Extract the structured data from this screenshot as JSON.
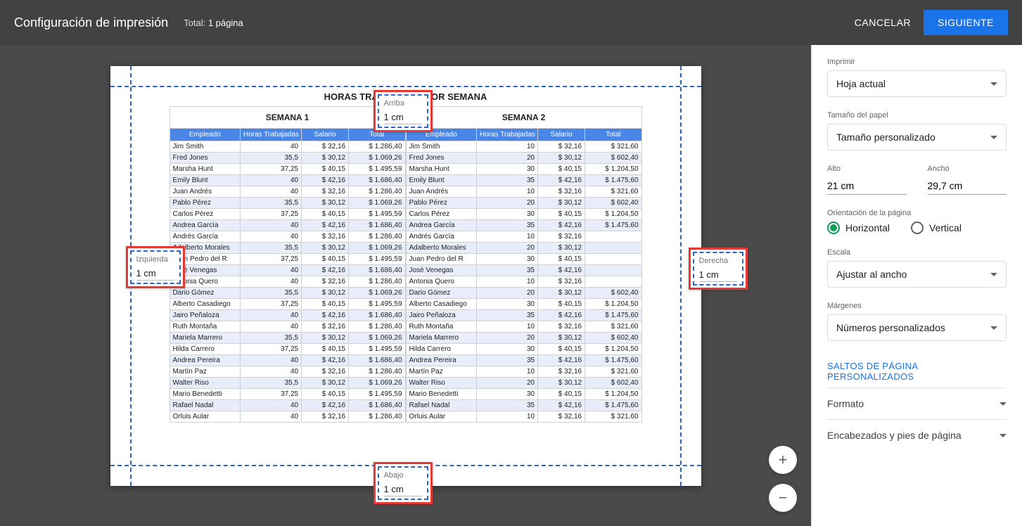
{
  "header": {
    "title": "Configuración de impresión",
    "total_label": "Total:",
    "total_value": "1 página",
    "cancel": "Cancelar",
    "next": "Siguiente"
  },
  "sidebar": {
    "print_label": "Imprimir",
    "print_value": "Hoja actual",
    "paper_label": "Tamaño del papel",
    "paper_value": "Tamaño personalizado",
    "height_label": "Alto",
    "height_value": "21 cm",
    "width_label": "Ancho",
    "width_value": "29,7 cm",
    "orient_label": "Orientación de la página",
    "orient_h": "Horizontal",
    "orient_v": "Vertical",
    "scale_label": "Escala",
    "scale_value": "Ajustar al ancho",
    "margins_label": "Márgenes",
    "margins_value": "Números personalizados",
    "page_breaks": "Saltos de página personalizados",
    "format": "Formato",
    "headers_footers": "Encabezados y pies de página"
  },
  "preview": {
    "doc_title": "HORAS TRABAJADAS POR SEMANA",
    "week1_title": "SEMANA 1",
    "week2_title": "SEMANA 2",
    "columns": {
      "emp": "Empleado",
      "hours": "Horas Trabajadas",
      "salary": "Salario",
      "total": "Total"
    },
    "margins": {
      "top_label": "Arriba",
      "top_value": "1 cm",
      "bottom_label": "Abajo",
      "bottom_value": "1 cm",
      "left_label": "Izquierda",
      "left_value": "1 cm",
      "right_label": "Derecha",
      "right_value": "1 cm"
    }
  },
  "chart_data": {
    "type": "table",
    "week1": [
      {
        "emp": "Jim Smith",
        "hours": "40",
        "salary": "$ 32,16",
        "total": "$ 1.286,40"
      },
      {
        "emp": "Fred Jones",
        "hours": "35,5",
        "salary": "$ 30,12",
        "total": "$ 1.069,26"
      },
      {
        "emp": "Marsha Hunt",
        "hours": "37,25",
        "salary": "$ 40,15",
        "total": "$ 1.495,59"
      },
      {
        "emp": "Emily Blunt",
        "hours": "40",
        "salary": "$ 42,16",
        "total": "$ 1.686,40"
      },
      {
        "emp": "Juan Andrés",
        "hours": "40",
        "salary": "$ 32,16",
        "total": "$ 1.286,40"
      },
      {
        "emp": "Pablo Pérez",
        "hours": "35,5",
        "salary": "$ 30,12",
        "total": "$ 1.069,26"
      },
      {
        "emp": "Carlos Pérez",
        "hours": "37,25",
        "salary": "$ 40,15",
        "total": "$ 1.495,59"
      },
      {
        "emp": "Andrea García",
        "hours": "40",
        "salary": "$ 42,16",
        "total": "$ 1.686,40"
      },
      {
        "emp": "Andrés García",
        "hours": "40",
        "salary": "$ 32,16",
        "total": "$ 1.286,40"
      },
      {
        "emp": "Adalberto Morales",
        "hours": "35,5",
        "salary": "$ 30,12",
        "total": "$ 1.069,26"
      },
      {
        "emp": "Juan Pedro del R",
        "hours": "37,25",
        "salary": "$ 40,15",
        "total": "$ 1.495,59"
      },
      {
        "emp": "José Venegas",
        "hours": "40",
        "salary": "$ 42,16",
        "total": "$ 1.686,40"
      },
      {
        "emp": "Antonia Quero",
        "hours": "40",
        "salary": "$ 32,16",
        "total": "$ 1.286,40"
      },
      {
        "emp": "Dario Gómez",
        "hours": "35,5",
        "salary": "$ 30,12",
        "total": "$ 1.069,26"
      },
      {
        "emp": "Alberto Casadiego",
        "hours": "37,25",
        "salary": "$ 40,15",
        "total": "$ 1.495,59"
      },
      {
        "emp": "Jairo Peñaloza",
        "hours": "40",
        "salary": "$ 42,16",
        "total": "$ 1.686,40"
      },
      {
        "emp": "Ruth Montaña",
        "hours": "40",
        "salary": "$ 32,16",
        "total": "$ 1.286,40"
      },
      {
        "emp": "Mariela Marrero",
        "hours": "35,5",
        "salary": "$ 30,12",
        "total": "$ 1.069,26"
      },
      {
        "emp": "Hilda Carrero",
        "hours": "37,25",
        "salary": "$ 40,15",
        "total": "$ 1.495,59"
      },
      {
        "emp": "Andrea Pereira",
        "hours": "40",
        "salary": "$ 42,16",
        "total": "$ 1.686,40"
      },
      {
        "emp": "Martín Paz",
        "hours": "40",
        "salary": "$ 32,16",
        "total": "$ 1.286,40"
      },
      {
        "emp": "Walter Riso",
        "hours": "35,5",
        "salary": "$ 30,12",
        "total": "$ 1.069,26"
      },
      {
        "emp": "Mario Benedetti",
        "hours": "37,25",
        "salary": "$ 40,15",
        "total": "$ 1.495,59"
      },
      {
        "emp": "Rafael Nadal",
        "hours": "40",
        "salary": "$ 42,16",
        "total": "$ 1.686,40"
      },
      {
        "emp": "Orluis Aular",
        "hours": "40",
        "salary": "$ 32,16",
        "total": "$ 1.286,40"
      }
    ],
    "week2": [
      {
        "emp": "Jim Smith",
        "hours": "10",
        "salary": "$ 32,16",
        "total": "$ 321,60"
      },
      {
        "emp": "Fred Jones",
        "hours": "20",
        "salary": "$ 30,12",
        "total": "$ 602,40"
      },
      {
        "emp": "Marsha Hunt",
        "hours": "30",
        "salary": "$ 40,15",
        "total": "$ 1.204,50"
      },
      {
        "emp": "Emily Blunt",
        "hours": "35",
        "salary": "$ 42,16",
        "total": "$ 1.475,60"
      },
      {
        "emp": "Juan Andrés",
        "hours": "10",
        "salary": "$ 32,16",
        "total": "$ 321,60"
      },
      {
        "emp": "Pablo Pérez",
        "hours": "20",
        "salary": "$ 30,12",
        "total": "$ 602,40"
      },
      {
        "emp": "Carlos Pérez",
        "hours": "30",
        "salary": "$ 40,15",
        "total": "$ 1.204,50"
      },
      {
        "emp": "Andrea García",
        "hours": "35",
        "salary": "$ 42,16",
        "total": "$ 1.475,60"
      },
      {
        "emp": "Andrés García",
        "hours": "10",
        "salary": "$ 32,16",
        "total": ""
      },
      {
        "emp": "Adalberto Morales",
        "hours": "20",
        "salary": "$ 30,12",
        "total": ""
      },
      {
        "emp": "Juan Pedro del R",
        "hours": "30",
        "salary": "$ 40,15",
        "total": ""
      },
      {
        "emp": "José Venegas",
        "hours": "35",
        "salary": "$ 42,16",
        "total": ""
      },
      {
        "emp": "Antonia Quero",
        "hours": "10",
        "salary": "$ 32,16",
        "total": ""
      },
      {
        "emp": "Dario Gómez",
        "hours": "20",
        "salary": "$ 30,12",
        "total": "$ 602,40"
      },
      {
        "emp": "Alberto Casadiego",
        "hours": "30",
        "salary": "$ 40,15",
        "total": "$ 1.204,50"
      },
      {
        "emp": "Jairo Peñaloza",
        "hours": "35",
        "salary": "$ 42,16",
        "total": "$ 1.475,60"
      },
      {
        "emp": "Ruth Montaña",
        "hours": "10",
        "salary": "$ 32,16",
        "total": "$ 321,60"
      },
      {
        "emp": "Mariela Marrero",
        "hours": "20",
        "salary": "$ 30,12",
        "total": "$ 602,40"
      },
      {
        "emp": "Hilda Carrero",
        "hours": "30",
        "salary": "$ 40,15",
        "total": "$ 1.204,50"
      },
      {
        "emp": "Andrea Pereira",
        "hours": "35",
        "salary": "$ 42,16",
        "total": "$ 1.475,60"
      },
      {
        "emp": "Martín Paz",
        "hours": "10",
        "salary": "$ 32,16",
        "total": "$ 321,60"
      },
      {
        "emp": "Walter Riso",
        "hours": "20",
        "salary": "$ 30,12",
        "total": "$ 602,40"
      },
      {
        "emp": "Mario Benedetti",
        "hours": "30",
        "salary": "$ 40,15",
        "total": "$ 1.204,50"
      },
      {
        "emp": "Rafael Nadal",
        "hours": "35",
        "salary": "$ 42,16",
        "total": "$ 1.475,60"
      },
      {
        "emp": "Orluis Aular",
        "hours": "10",
        "salary": "$ 32,16",
        "total": "$ 321,60"
      }
    ]
  },
  "zoom": {
    "in": "+",
    "out": "−"
  }
}
